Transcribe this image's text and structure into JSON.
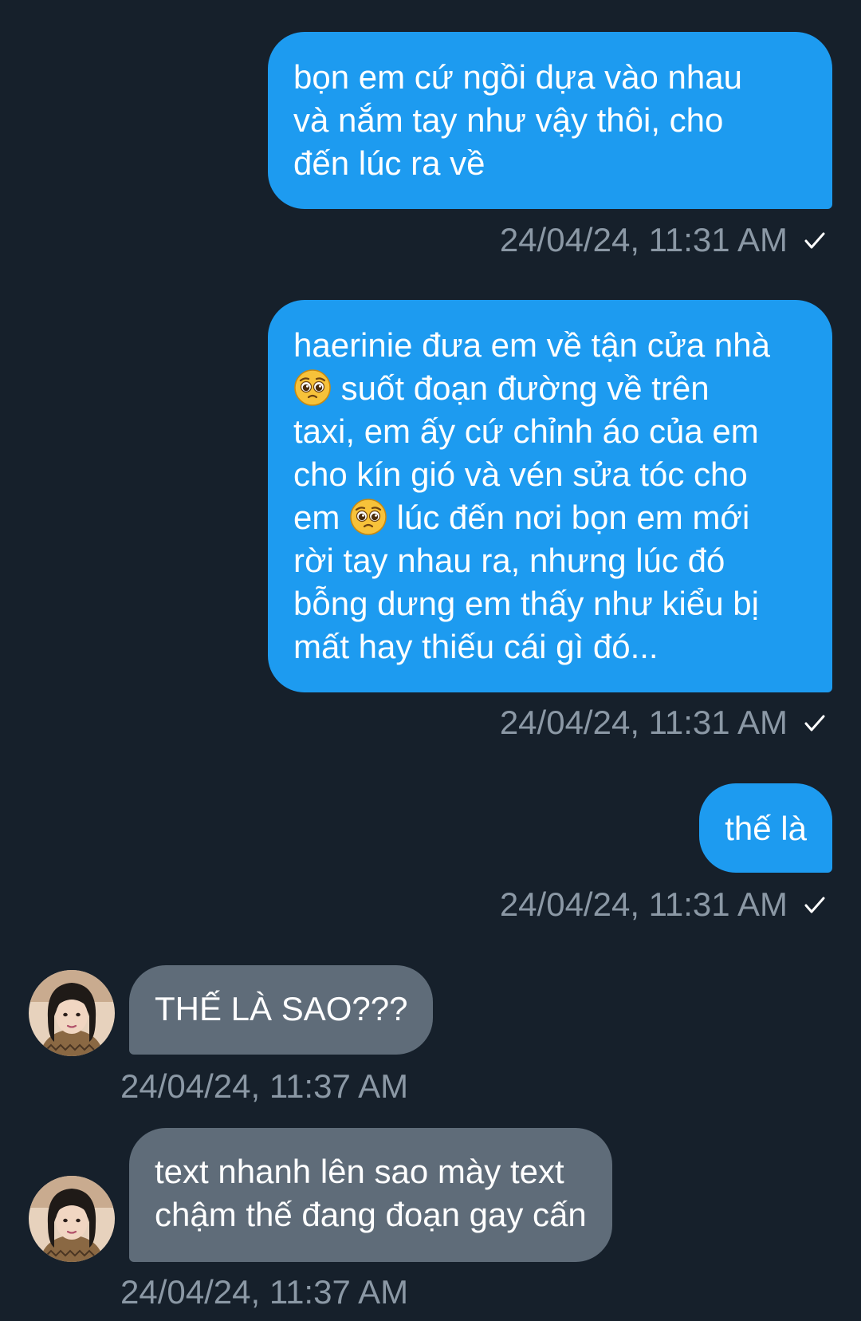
{
  "messages": [
    {
      "side": "sent",
      "parts": [
        "bọn em cứ ngồi dựa vào nhau\nvà nắm tay như vậy thôi, cho\nđến lúc ra về"
      ],
      "timestamp": "24/04/24, 11:31 AM"
    },
    {
      "side": "sent",
      "parts": [
        "haerinie đưa em về tận cửa nhà\n",
        " suốt đoạn đường về trên\ntaxi, em ấy cứ chỉnh áo của em\ncho kín gió và vén sửa tóc cho\nem ",
        " lúc đến nơi bọn em mới\nrời tay nhau ra, nhưng lúc đó\nbỗng dưng em thấy như kiểu bị\nmất hay thiếu cái gì đó..."
      ],
      "emoji": "pleading-face",
      "timestamp": "24/04/24, 11:31 AM"
    },
    {
      "side": "sent",
      "parts": [
        "thế là"
      ],
      "timestamp": "24/04/24, 11:31 AM"
    },
    {
      "side": "received",
      "parts": [
        "THẾ LÀ SAO???"
      ],
      "timestamp": "24/04/24, 11:37 AM"
    },
    {
      "side": "received",
      "parts": [
        "text nhanh lên sao mày text\nchậm thế đang đoạn gay cấn"
      ],
      "timestamp": "24/04/24, 11:37 AM"
    }
  ],
  "icons": {
    "read_receipt": "check-icon",
    "emoji": "pleading-face-emoji",
    "avatar": "avatar"
  },
  "colors": {
    "background": "#16202b",
    "sent_bubble": "#1d9bf0",
    "received_bubble": "#5f6c79",
    "timestamp": "#8b98a5"
  }
}
